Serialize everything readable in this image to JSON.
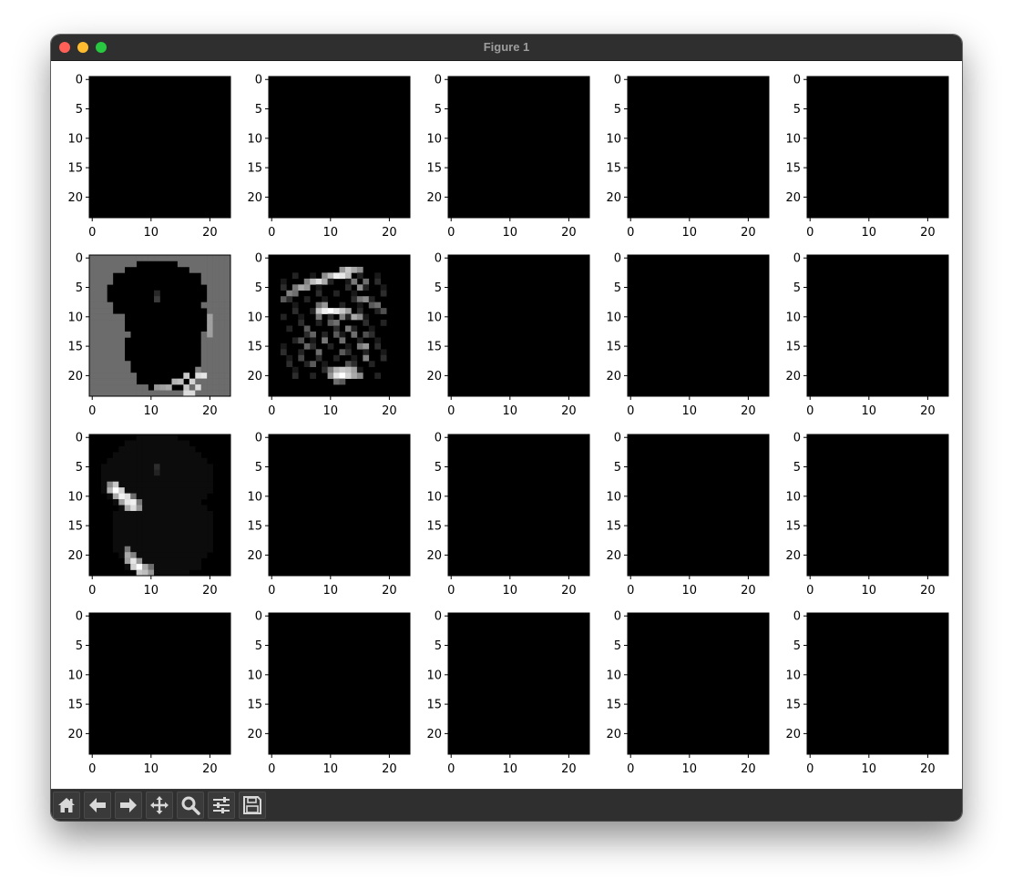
{
  "window": {
    "title": "Figure 1"
  },
  "toolbar": {
    "buttons": [
      {
        "name": "home-button",
        "icon": "home-icon"
      },
      {
        "name": "back-button",
        "icon": "arrow-left-icon"
      },
      {
        "name": "forward-button",
        "icon": "arrow-right-icon"
      },
      {
        "name": "pan-button",
        "icon": "move-icon"
      },
      {
        "name": "zoom-button",
        "icon": "magnifier-icon"
      },
      {
        "name": "configure-subplots-button",
        "icon": "sliders-icon"
      },
      {
        "name": "save-button",
        "icon": "floppy-disk-icon"
      }
    ]
  },
  "chart_data": {
    "type": "heatmap",
    "rows": 4,
    "cols": 5,
    "colormap": "gray",
    "image_size": [
      24,
      24
    ],
    "xticks": [
      "0",
      "10",
      "20"
    ],
    "yticks": [
      "0",
      "5",
      "10",
      "15",
      "20"
    ],
    "panels": [
      {
        "index": 0,
        "content": "all-black"
      },
      {
        "index": 1,
        "content": "all-black"
      },
      {
        "index": 2,
        "content": "all-black"
      },
      {
        "index": 3,
        "content": "all-black"
      },
      {
        "index": 4,
        "content": "all-black"
      },
      {
        "index": 5,
        "content": "gray-background-dark-digit-8"
      },
      {
        "index": 6,
        "content": "bright-edges-digit-8"
      },
      {
        "index": 7,
        "content": "all-black"
      },
      {
        "index": 8,
        "content": "all-black"
      },
      {
        "index": 9,
        "content": "all-black"
      },
      {
        "index": 10,
        "content": "diagonal-strokes-left"
      },
      {
        "index": 11,
        "content": "all-black"
      },
      {
        "index": 12,
        "content": "all-black"
      },
      {
        "index": 13,
        "content": "all-black"
      },
      {
        "index": 14,
        "content": "all-black"
      },
      {
        "index": 15,
        "content": "all-black"
      },
      {
        "index": 16,
        "content": "all-black"
      },
      {
        "index": 17,
        "content": "all-black"
      },
      {
        "index": 18,
        "content": "all-black"
      },
      {
        "index": 19,
        "content": "all-black"
      }
    ]
  }
}
